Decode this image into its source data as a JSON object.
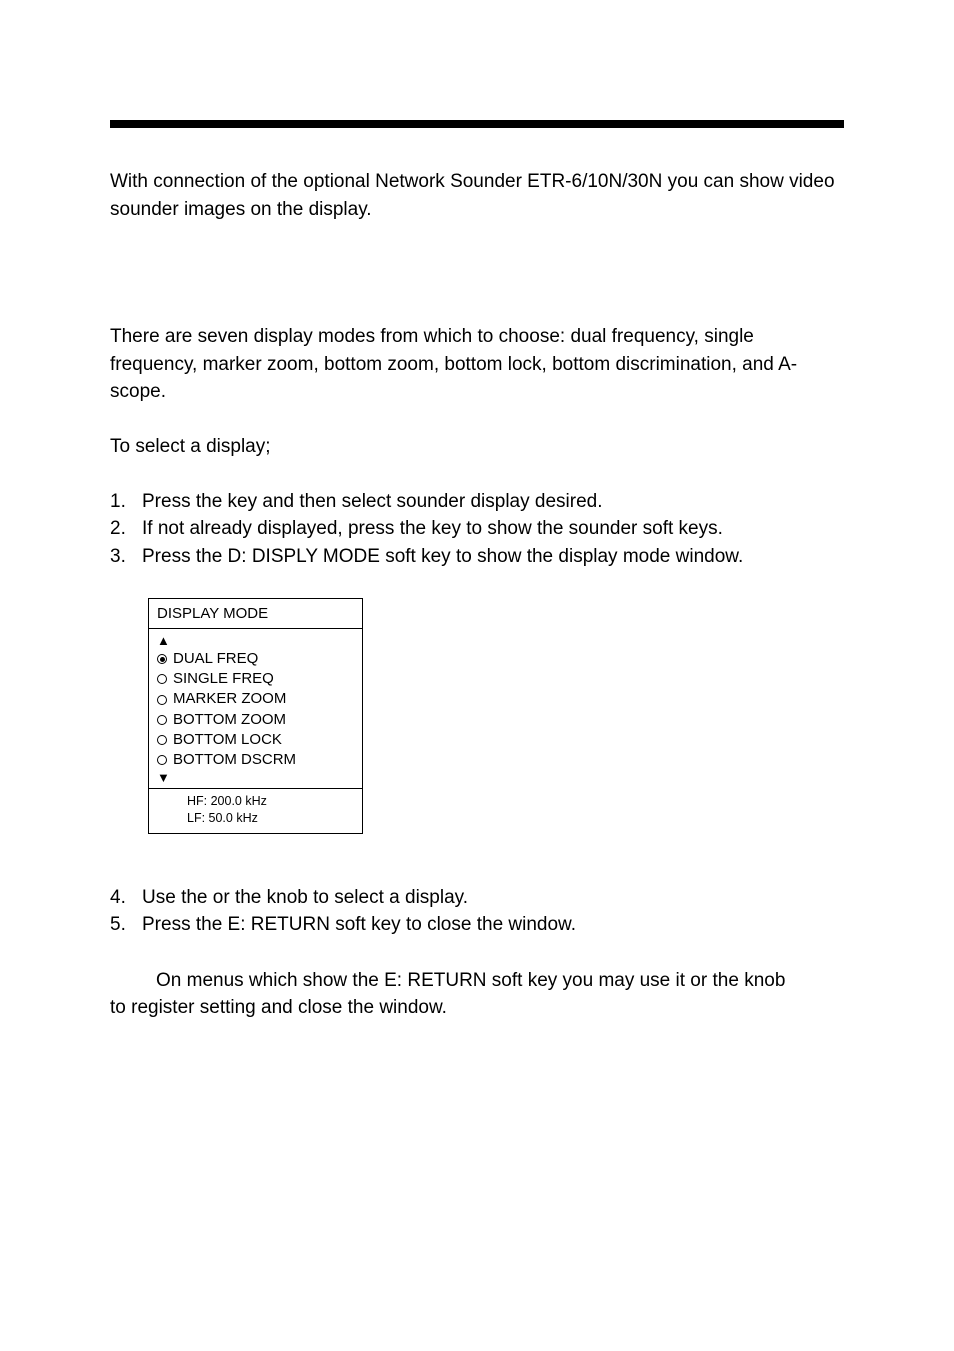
{
  "intro": "With connection of the optional Network Sounder ETR-6/10N/30N you can show video sounder images on the display.",
  "section_desc": "There are seven display modes from which to choose: dual frequency, single frequency, marker zoom, bottom zoom, bottom lock, bottom discrimination, and A-scope.",
  "subhead": "To select a display;",
  "steps1": [
    {
      "num": "1.",
      "before": "Press the ",
      "mid": " key and then select sounder display desired.",
      "after": ""
    },
    {
      "num": "2.",
      "before": "If not already displayed, press the ",
      "mid": "",
      "after": " key to show the sounder soft keys."
    },
    {
      "num": "3.",
      "before": "Press the D: DISPLY MODE soft key to show the display mode window.",
      "mid": "",
      "after": ""
    }
  ],
  "display_mode": {
    "title": "DISPLAY MODE",
    "up": "▲",
    "down": "▼",
    "options": [
      {
        "label": "DUAL FREQ",
        "selected": true
      },
      {
        "label": "SINGLE FREQ",
        "selected": false
      },
      {
        "label": "MARKER ZOOM",
        "selected": false
      },
      {
        "label": "BOTTOM ZOOM",
        "selected": false
      },
      {
        "label": "BOTTOM LOCK",
        "selected": false
      },
      {
        "label": "BOTTOM DSCRM",
        "selected": false
      }
    ],
    "hf": "HF: 200.0 kHz",
    "lf": "LF:   50.0 kHz"
  },
  "steps2": [
    {
      "num": "4.",
      "text_a": "Use the ",
      "text_b": " or the ",
      "text_c": " knob to select a display."
    },
    {
      "num": "5.",
      "text_a": "Press the E: RETURN soft key to close the window.",
      "text_b": "",
      "text_c": ""
    }
  ],
  "note": {
    "line1a": "On menus which show the E: RETURN soft key you may use it or the ",
    "line1b": " knob",
    "line2": "to register setting and close the window."
  }
}
